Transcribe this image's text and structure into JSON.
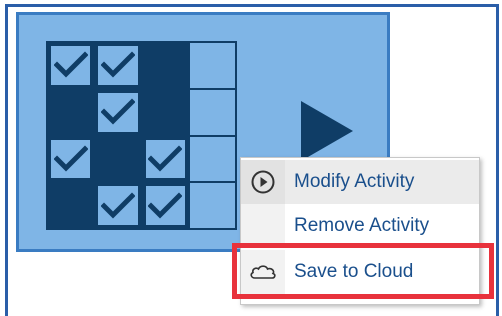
{
  "activity_tile": {
    "grid": [
      [
        true,
        true,
        false,
        null
      ],
      [
        false,
        true,
        null,
        null
      ],
      [
        true,
        false,
        true,
        null
      ],
      [
        null,
        true,
        true,
        null
      ]
    ]
  },
  "context_menu": {
    "items": [
      {
        "label": "Modify Activity",
        "icon": "play-circle-icon"
      },
      {
        "label": "Remove Activity",
        "icon": ""
      },
      {
        "label": "Save to Cloud",
        "icon": "cloud-icon"
      }
    ]
  },
  "colors": {
    "tile_background": "#7fb5e6",
    "tile_dark": "#0f3d66",
    "menu_text": "#1a4f8c",
    "highlight": "#e8323c"
  }
}
